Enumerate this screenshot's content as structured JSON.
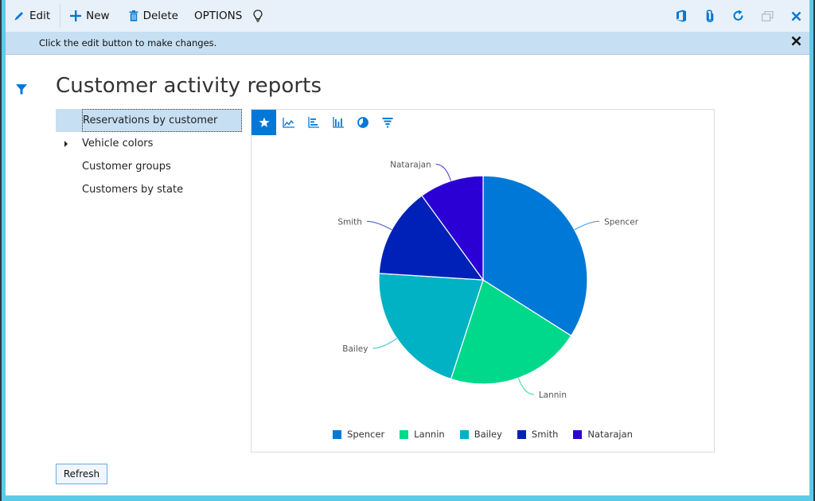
{
  "toolbar": {
    "edit_label": "Edit",
    "new_label": "New",
    "delete_label": "Delete",
    "options_label": "OPTIONS",
    "right_icons": [
      "office-icon",
      "attachment-icon",
      "refresh-icon",
      "restore-window-icon",
      "close-icon"
    ]
  },
  "message_bar": {
    "text": "Click the edit button to make changes."
  },
  "page": {
    "title": "Customer activity reports"
  },
  "nav": {
    "items": [
      {
        "label": "Reservations by customer",
        "selected": true,
        "expandable": false
      },
      {
        "label": "Vehicle colors",
        "selected": false,
        "expandable": true
      },
      {
        "label": "Customer groups",
        "selected": false,
        "expandable": false
      },
      {
        "label": "Customers by state",
        "selected": false,
        "expandable": false
      }
    ]
  },
  "chart_tools": [
    "star-icon",
    "line-chart-icon",
    "horizontal-bar-chart-icon",
    "column-chart-icon",
    "pie-chart-icon",
    "funnel-chart-icon"
  ],
  "chart_data": {
    "type": "pie",
    "title": "Reservations by customer",
    "categories": [
      "Spencer",
      "Lannin",
      "Bailey",
      "Smith",
      "Natarajan"
    ],
    "values": [
      34,
      21,
      21,
      14,
      10
    ],
    "colors": [
      "#0078d7",
      "#00d98b",
      "#00b2c4",
      "#0021b8",
      "#2b00d5"
    ],
    "start_angle": "top",
    "direction": "clockwise",
    "legend": [
      "Spencer",
      "Lannin",
      "Bailey",
      "Smith",
      "Natarajan"
    ],
    "legend_position": "bottom"
  },
  "buttons": {
    "refresh_label": "Refresh"
  }
}
